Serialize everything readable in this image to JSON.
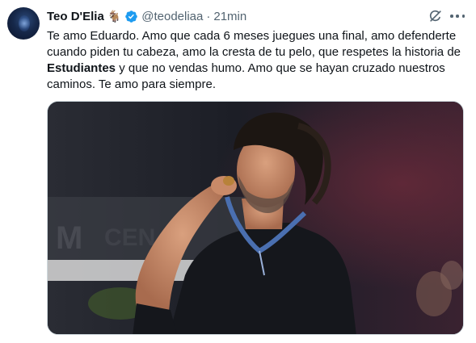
{
  "author": {
    "name": "Teo D'Elia",
    "emoji_icon": "goat-icon",
    "handle": "@teodeliaa",
    "separator": "·",
    "time": "21min",
    "verified_color": "#1d9bf0"
  },
  "tweet": {
    "text_part1": "Te amo Eduardo. Amo que cada 6 meses juegues una final, amo defenderte cuando piden tu cabeza, amo la cresta de tu pelo, que respetes la historia de ",
    "text_bold": "Estudiantes",
    "text_part2": " y que no vendas humo. Amo que se hayan cruzado nuestros caminos. Te amo para siempre."
  },
  "actions": {
    "grok_icon": "grok-icon",
    "more_icon": "more-icon"
  }
}
